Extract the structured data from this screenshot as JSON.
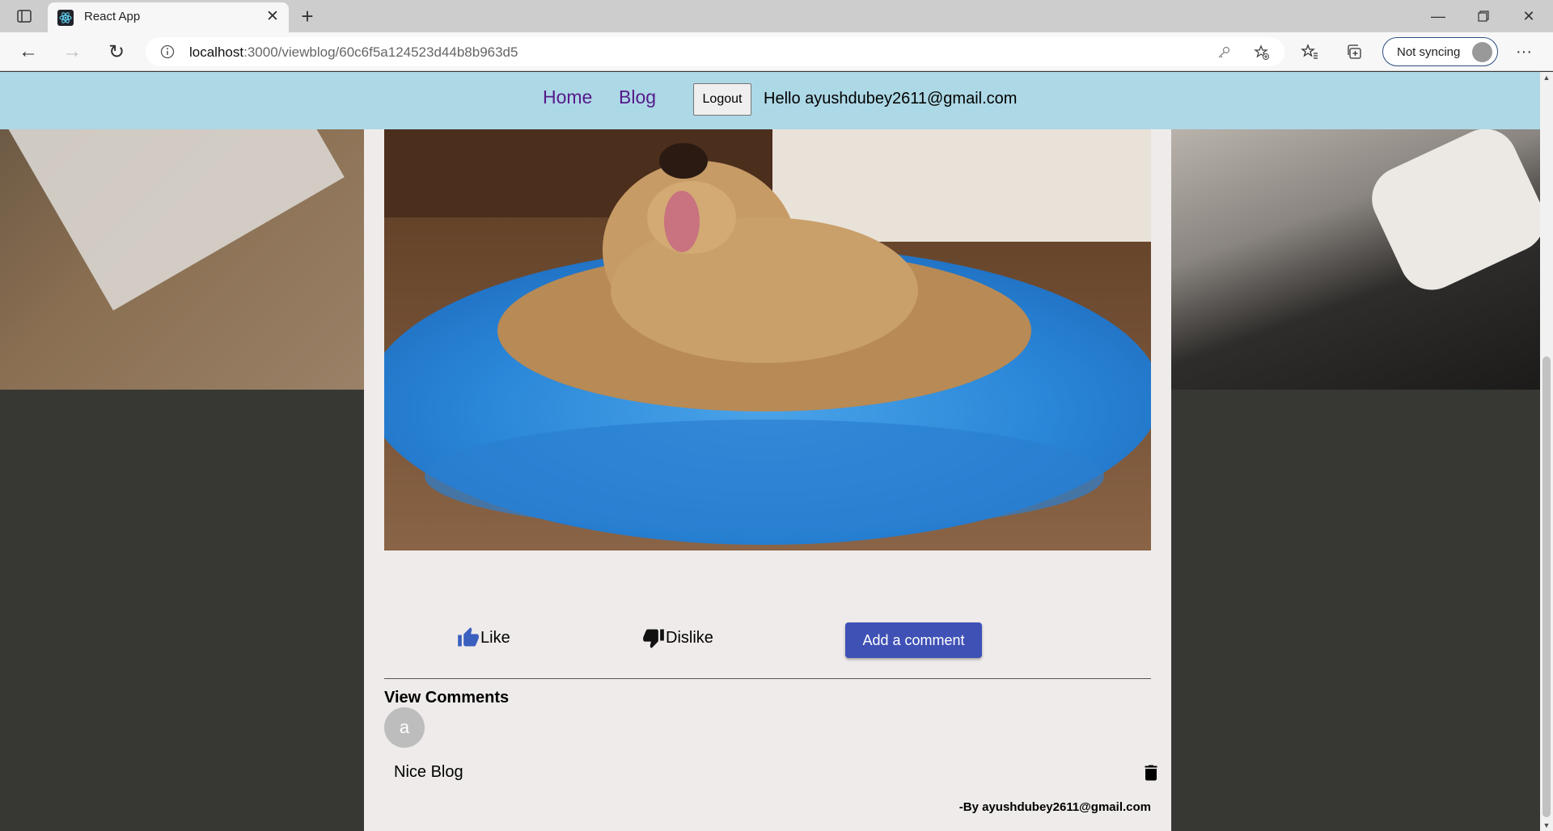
{
  "browser": {
    "tab_title": "React App",
    "url_host": "localhost",
    "url_rest": ":3000/viewblog/60c6f5a124523d44b8b963d5",
    "sync_label": "Not syncing"
  },
  "nav": {
    "home": "Home",
    "blog": "Blog",
    "logout": "Logout",
    "greeting": "Hello ayushdubey2611@gmail.com"
  },
  "post": {
    "image_alt": "Dog lying in a blue fluffy bed",
    "like_label": "Like",
    "dislike_label": "Dislike",
    "add_comment_label": "Add a comment"
  },
  "comments": {
    "heading": "View Comments",
    "items": [
      {
        "avatar_letter": "a",
        "text": "Nice Blog",
        "author": "-By ayushdubey2611@gmail.com"
      }
    ]
  },
  "colors": {
    "navbar": "#add8e6",
    "link": "#551a8b",
    "primary_button": "#3f51b5",
    "like_icon": "#3b5fbf",
    "page_bg": "#373833",
    "content_bg": "#efebea"
  },
  "icons": [
    "sidebar-icon",
    "react-icon",
    "close-icon",
    "plus-icon",
    "minimize-icon",
    "restore-icon",
    "back-icon",
    "forward-icon",
    "refresh-icon",
    "info-icon",
    "key-icon",
    "add-favorite-icon",
    "favorites-icon",
    "collections-icon",
    "more-icon",
    "thumbs-up-icon",
    "thumbs-down-icon",
    "trash-icon"
  ]
}
